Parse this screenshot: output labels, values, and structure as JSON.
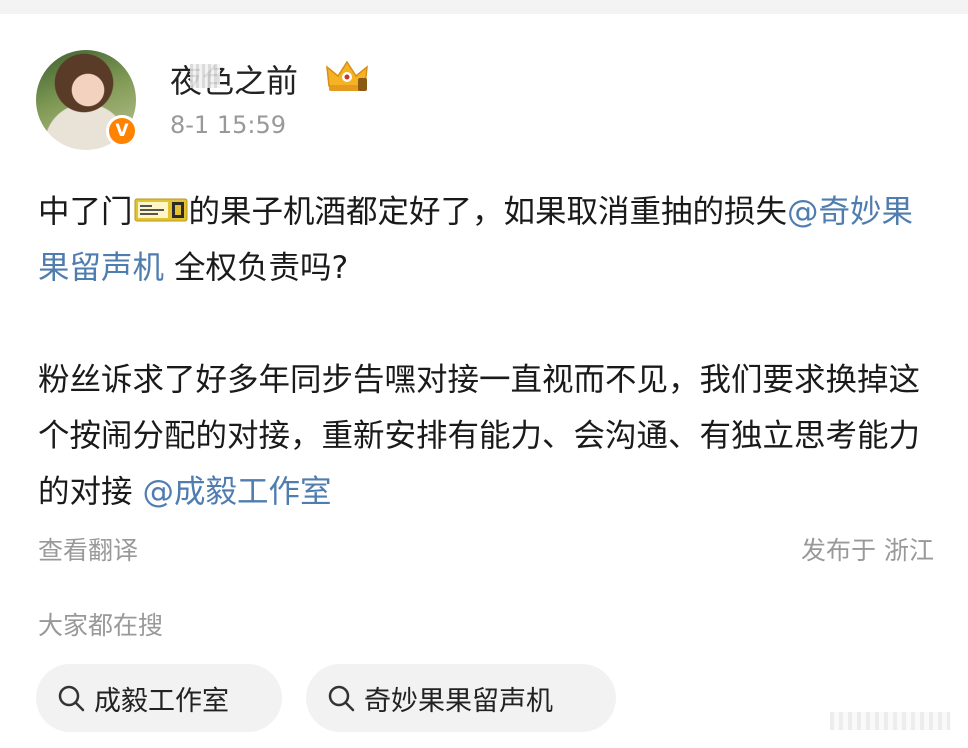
{
  "post": {
    "username": "夜色之前",
    "timestamp": "8-1 15:59",
    "content": {
      "p1_a": "中了门",
      "ticket_icon": "ticket-emoji-icon",
      "p1_b": "的果子机酒都定好了，如果取消重抽的损失",
      "p1_mention": "@奇妙果果留声机",
      "p1_c": " 全权负责吗?",
      "p2_a": "粉丝诉求了好多年同步告嘿对接一直视而不见，我们要求换掉这个按闹分配的对接，重新安排有能力、会沟通、有独立思考能力的对接",
      "p2_mention": "@成毅工作室"
    },
    "translate_label": "查看翻译",
    "location": "发布于 浙江",
    "badge_text": "V"
  },
  "search": {
    "heading": "大家都在搜",
    "chips": [
      {
        "label": "成毅工作室",
        "icon": "search-icon"
      },
      {
        "label": "奇妙果果留声机",
        "icon": "search-icon"
      }
    ]
  },
  "colors": {
    "mention": "#507daf",
    "muted": "#999999",
    "verified_badge": "#ff8200",
    "chip_bg": "#f2f2f2"
  }
}
